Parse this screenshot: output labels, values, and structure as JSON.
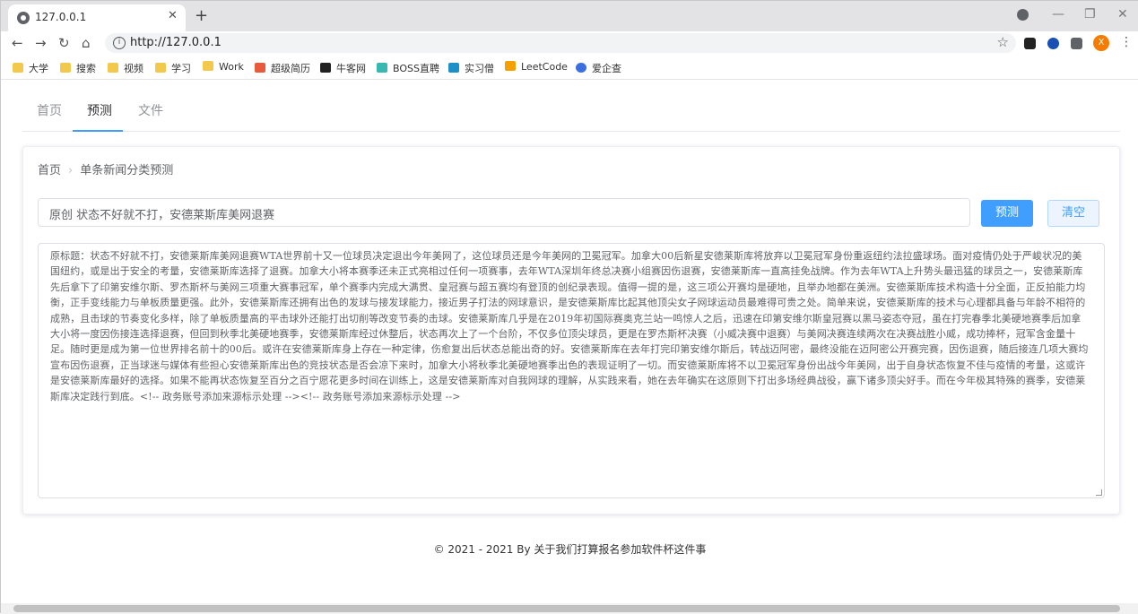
{
  "browser": {
    "tab_title": "127.0.0.1",
    "url": "http://127.0.0.1",
    "profile_initial": "X",
    "bookmarks": [
      {
        "label": "大学",
        "icon": "folder-icon"
      },
      {
        "label": "搜索",
        "icon": "folder-icon"
      },
      {
        "label": "视频",
        "icon": "folder-icon"
      },
      {
        "label": "学习",
        "icon": "folder-icon"
      },
      {
        "label": "Work",
        "icon": "folder-icon"
      },
      {
        "label": "超级简历",
        "icon": "resume-site-icon"
      },
      {
        "label": "牛客网",
        "icon": "nowcoder-icon"
      },
      {
        "label": "BOSS直聘",
        "icon": "boss-icon"
      },
      {
        "label": "实习僧",
        "icon": "shixiseng-icon"
      },
      {
        "label": "LeetCode",
        "icon": "leetcode-icon"
      },
      {
        "label": "爱企查",
        "icon": "aiqicha-icon"
      }
    ]
  },
  "nav_tabs": [
    {
      "label": "首页",
      "active": false
    },
    {
      "label": "预测",
      "active": true
    },
    {
      "label": "文件",
      "active": false
    }
  ],
  "breadcrumb": {
    "home": "首页",
    "current": "单条新闻分类预测"
  },
  "form": {
    "input_value": "原创 状态不好就不打，安德莱斯库美网退赛",
    "predict_label": "预测",
    "clear_label": "清空",
    "textarea_value": "原标题：状态不好就不打，安德莱斯库美网退赛WTA世界前十又一位球员决定退出今年美网了，这位球员还是今年美网的卫冕冠军。加拿大00后新星安德莱斯库将放弃以卫冕冠军身份重返纽约法拉盛球场。面对疫情仍处于严峻状况的美国纽约，或是出于安全的考量，安德莱斯库选择了退赛。加拿大小将本赛季还未正式亮相过任何一项赛事，去年WTA深圳年终总决赛小组赛因伤退赛，安德莱斯库一直高挂免战牌。作为去年WTA上升势头最迅猛的球员之一，安德莱斯库先后拿下了印第安维尔斯、罗杰斯杯与美网三项重大赛事冠军，单个赛季内完成大满贯、皇冠赛与超五赛均有登顶的创纪录表现。值得一提的是，这三项公开赛均是硬地，且举办地都在美洲。安德莱斯库技术构造十分全面，正反拍能力均衡，正手变线能力与单板质量更强。此外，安德莱斯库还拥有出色的发球与接发球能力，接近男子打法的网球意识，是安德莱斯库比起其他顶尖女子网球运动员最难得可贵之处。简单来说，安德莱斯库的技术与心理都具备与年龄不相符的成熟，且击球的节奏变化多样，除了单板质量高的平击球外还能打出切削等改变节奏的击球。安德莱斯库几乎是在2019年初国际赛奥克兰站一鸣惊人之后，迅速在印第安维尔斯皇冠赛以黑马姿态夺冠，虽在打完春季北美硬地赛季后加拿大小将一度因伤接连选择退赛，但回到秋季北美硬地赛季，安德莱斯库经过休整后，状态再次上了一个台阶，不仅多位顶尖球员，更是在罗杰斯杯决赛（小威决赛中退赛）与美网决赛连续两次在决赛战胜小威，成功捧杯，冠军含金量十足。随时更是成为第一位世界排名前十的00后。或许在安德莱斯库身上存在一种定律，伤愈复出后状态总能出奇的好。安德莱斯库在去年打完印第安维尔斯后，转战迈阿密，最终没能在迈阿密公开赛完赛，因伤退赛，随后接连几项大赛均宣布因伤退赛，正当球迷与媒体有些担心安德莱斯库出色的竞技状态是否会凉下来时，加拿大小将秋季北美硬地赛季出色的表现证明了一切。而安德莱斯库将不以卫冕冠军身份出战今年美网，出于自身状态恢复不佳与疫情的考量，这或许是安德莱斯库最好的选择。如果不能再状态恢复至百分之百宁愿花更多时间在训练上，这是安德莱斯库对自我网球的理解，从实践来看，她在去年确实在这原则下打出多场经典战役，赢下诸多顶尖好手。而在今年极其特殊的赛季，安德莱斯库决定践行到底。<!-- 政务账号添加来源标示处理 --><!-- 政务账号添加来源标示处理 -->"
  },
  "footer": {
    "text": "© 2021 - 2021 By 关于我们打算报名参加软件杯这件事"
  }
}
